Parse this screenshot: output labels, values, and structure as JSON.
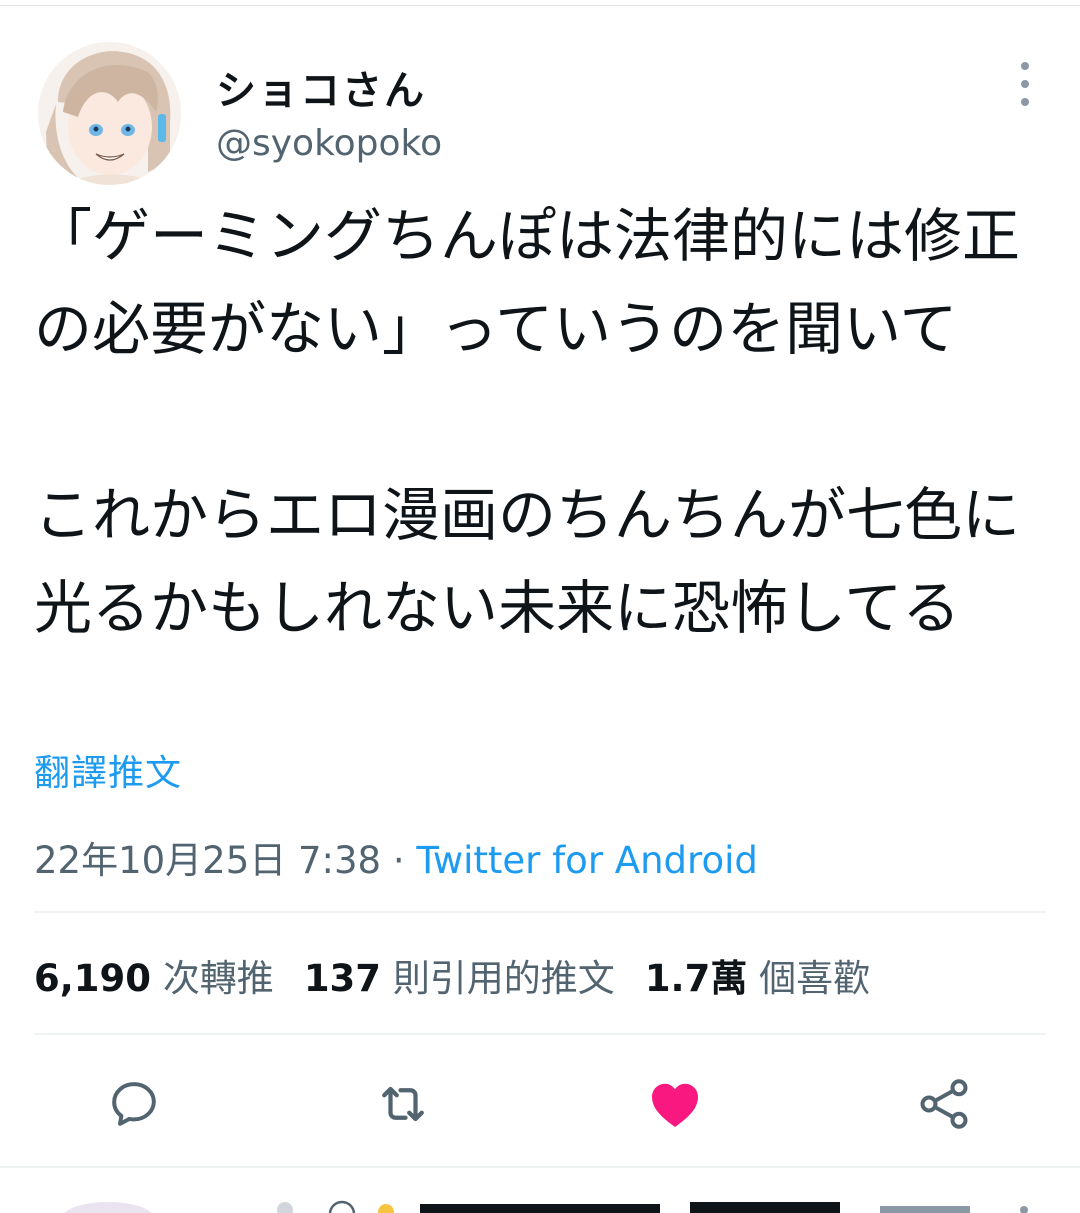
{
  "tweet": {
    "display_name": "ショコさん",
    "handle": "@syokopoko",
    "text": "「ゲーミングちんぽは法律的には修正の必要がない」っていうのを聞いて\n\nこれからエロ漫画のちんちんが七色に光るかもしれない未来に恐怖してる",
    "translate_label": "翻譯推文",
    "timestamp": "22年10月25日 7:38",
    "separator": " · ",
    "source": "Twitter for Android"
  },
  "stats": {
    "retweets_count": "6,190",
    "retweets_label": "次轉推",
    "quotes_count": "137",
    "quotes_label": "則引用的推文",
    "likes_count": "1.7萬",
    "likes_label": "個喜歡"
  },
  "actions": {
    "icons": [
      "reply-icon",
      "retweet-icon",
      "like-icon",
      "share-icon"
    ],
    "liked": true
  },
  "colors": {
    "accent": "#1d9bf0",
    "like": "#f91880",
    "secondary_text": "#536471",
    "primary_text": "#0f1419"
  }
}
